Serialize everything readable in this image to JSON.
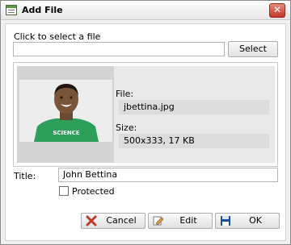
{
  "window": {
    "title": "Add File",
    "close_glyph": "✕"
  },
  "file_picker": {
    "label": "Click to select a file",
    "value": "",
    "select_label": "Select"
  },
  "preview": {
    "shirt_text": "SCIENCE",
    "file_label": "File:",
    "file_value": "jbettina.jpg",
    "size_label": "Size:",
    "size_value": "500x333, 17 KB"
  },
  "title_field": {
    "label": "Title:",
    "value": "John Bettina"
  },
  "protected": {
    "label": "Protected",
    "checked": false
  },
  "buttons": {
    "cancel": "Cancel",
    "edit": "Edit",
    "ok": "OK"
  },
  "colors": {
    "cancel_icon": "#c0392b",
    "ok_icon": "#1f4e9c",
    "edit_icon": "#d9a441",
    "shirt": "#2e9e5b"
  },
  "icons": {
    "window": "form-icon",
    "cancel": "red-x-icon",
    "edit": "edit-hand-icon",
    "ok": "floppy-disk-icon"
  }
}
